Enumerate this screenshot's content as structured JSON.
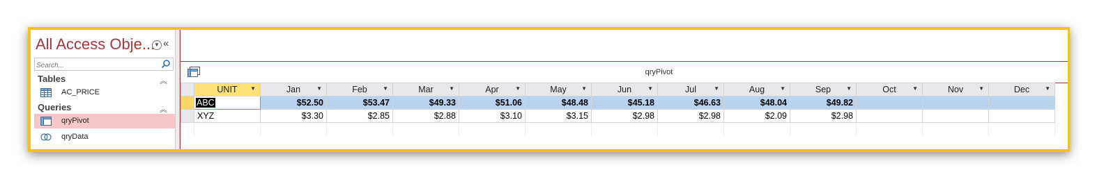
{
  "nav": {
    "title": "All Access Obje...",
    "search_placeholder": "Search...",
    "groups": [
      {
        "label": "Tables",
        "items": [
          {
            "label": "AC_PRICE"
          }
        ]
      },
      {
        "label": "Queries",
        "items": [
          {
            "label": "qryPivot"
          },
          {
            "label": "qryData"
          }
        ]
      }
    ]
  },
  "document": {
    "title": "qryPivot"
  },
  "grid": {
    "columns": [
      "UNIT",
      "Jan",
      "Feb",
      "Mar",
      "Apr",
      "May",
      "Jun",
      "Jul",
      "Aug",
      "Sep",
      "Oct",
      "Nov",
      "Dec"
    ],
    "rows": [
      {
        "unit": "ABC",
        "values": [
          "$52.50",
          "$53.47",
          "$49.33",
          "$51.06",
          "$48.48",
          "$45.18",
          "$46.63",
          "$48.04",
          "$49.82",
          "",
          "",
          ""
        ]
      },
      {
        "unit": "XYZ",
        "values": [
          "$3.30",
          "$2.85",
          "$2.88",
          "$3.10",
          "$3.15",
          "$2.98",
          "$2.98",
          "$2.09",
          "$2.98",
          "",
          "",
          ""
        ]
      }
    ]
  },
  "colors": {
    "accent": "#a4373a",
    "frame": "#f2c418",
    "selected_row": "#b9d3ef",
    "selected_nav": "#f6c6c9"
  }
}
